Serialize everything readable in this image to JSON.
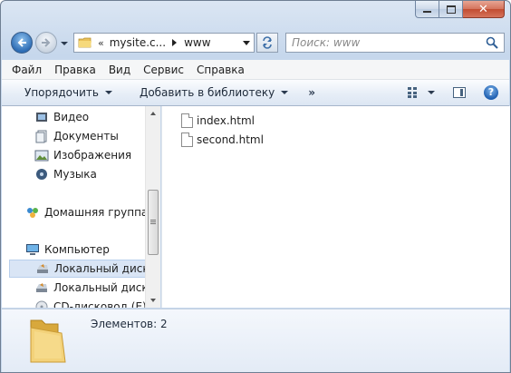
{
  "window": {
    "caption_buttons": [
      "minimize-icon",
      "maximize-icon",
      "close-icon"
    ],
    "close_glyph": "✕"
  },
  "address_bar": {
    "overflow": "«",
    "crumbs": [
      "mysite.c...",
      "www"
    ]
  },
  "search": {
    "placeholder": "Поиск: www"
  },
  "menu": {
    "items": [
      "Файл",
      "Правка",
      "Вид",
      "Сервис",
      "Справка"
    ]
  },
  "command_bar": {
    "organize": "Упорядочить",
    "add_to_library": "Добавить в библиотеку",
    "more": "»",
    "help": "?"
  },
  "navigation": {
    "items": [
      {
        "label": "Видео",
        "icon": "video-library-icon"
      },
      {
        "label": "Документы",
        "icon": "documents-library-icon"
      },
      {
        "label": "Изображения",
        "icon": "pictures-library-icon"
      },
      {
        "label": "Музыка",
        "icon": "music-library-icon"
      },
      {
        "label": "Домашняя группа",
        "icon": "homegroup-icon"
      },
      {
        "label": "Компьютер",
        "icon": "computer-icon"
      },
      {
        "label": "Локальный диск (C",
        "icon": "hard-drive-icon",
        "selected": true
      },
      {
        "label": "Локальный диск (D",
        "icon": "hard-drive-icon"
      },
      {
        "label": "CD-дисковод (E)",
        "icon": "cd-drive-icon"
      }
    ]
  },
  "files": [
    {
      "name": "index.html",
      "icon": "document-icon"
    },
    {
      "name": "second.html",
      "icon": "document-icon"
    }
  ],
  "details": {
    "icon": "folder-icon",
    "status": "Элементов: 2"
  },
  "colors": {
    "selection": "#d9e5f5",
    "accent": "#2e6db5",
    "close": "#c24c31"
  }
}
